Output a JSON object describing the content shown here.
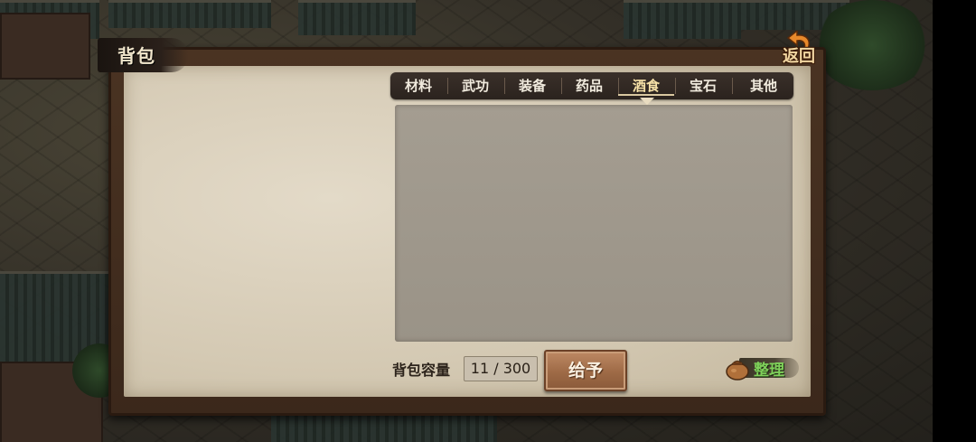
{
  "window": {
    "title": "背包"
  },
  "back_button": {
    "label": "返回",
    "icon": "back-arrow-icon"
  },
  "tabs": [
    {
      "label": "材料",
      "active": false
    },
    {
      "label": "武功",
      "active": false
    },
    {
      "label": "装备",
      "active": false
    },
    {
      "label": "药品",
      "active": false
    },
    {
      "label": "酒食",
      "active": true
    },
    {
      "label": "宝石",
      "active": false
    },
    {
      "label": "其他",
      "active": false
    }
  ],
  "inventory": {
    "capacity_label": "背包容量",
    "capacity_value": "11 / 300",
    "items": []
  },
  "actions": {
    "give_label": "给予",
    "sort_label": "整理",
    "sort_icon": "bag-icon"
  },
  "colors": {
    "accent_gold": "#f7e2a8",
    "sort_green": "#7fd05a",
    "button_brown": "#9e6a46"
  }
}
